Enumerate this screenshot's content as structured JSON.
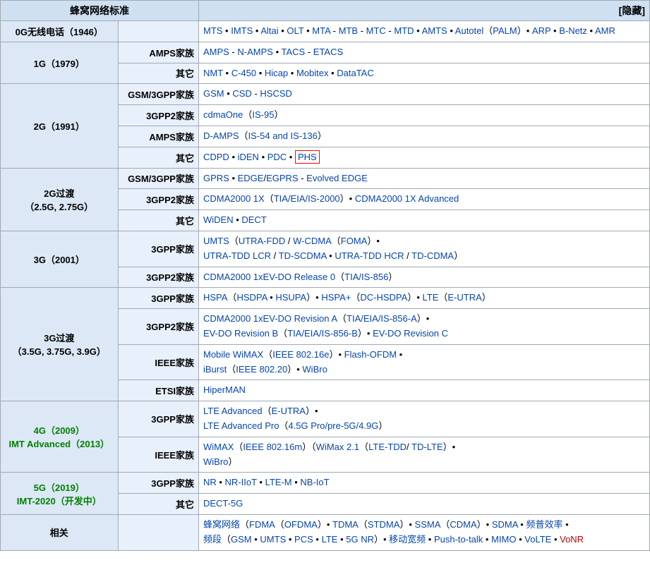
{
  "table": {
    "title": "蜂窝网络标准",
    "hide_label": "[隐藏]",
    "rows": [
      {
        "gen": "0G无线电话（1946）",
        "gen_color": "normal",
        "rowspan": 1,
        "families": [
          {
            "family": "",
            "content": "MTS • IMTS • Altai • OLT • MTA - MTB - MTC - MTD • AMTS • Autotel（PALM）• ARP • B-Netz • AMR"
          }
        ]
      },
      {
        "gen": "1G（1979）",
        "gen_color": "normal",
        "rowspan": 2,
        "families": [
          {
            "family": "AMPS家族",
            "content": "AMPS - N-AMPS • TACS - ETACS"
          },
          {
            "family": "其它",
            "content": "NMT • C-450 • Hicap • Mobitex • DataTAC"
          }
        ]
      },
      {
        "gen": "2G（1991）",
        "gen_color": "normal",
        "rowspan": 4,
        "families": [
          {
            "family": "GSM/3GPP家族",
            "content": "GSM • CSD - HSCSD"
          },
          {
            "family": "3GPP2家族",
            "content": "cdmaOne（IS-95）"
          },
          {
            "family": "AMPS家族",
            "content": "D-AMPS（IS-54 and IS-136）"
          },
          {
            "family": "其它",
            "content": "CDPD • iDEN • PDC • PHS",
            "phs": true
          }
        ]
      },
      {
        "gen": "2G过渡\n（2.5G, 2.75G）",
        "gen_color": "normal",
        "rowspan": 3,
        "families": [
          {
            "family": "GSM/3GPP家族",
            "content": "GPRS • EDGE/EGPRS - Evolved EDGE"
          },
          {
            "family": "3GPP2家族",
            "content": "CDMA2000 1X（TIA/EIA/IS-2000）• CDMA2000 1X Advanced"
          },
          {
            "family": "其它",
            "content": "WiDEN • DECT"
          }
        ]
      },
      {
        "gen": "3G（2001）",
        "gen_color": "normal",
        "rowspan": 2,
        "families": [
          {
            "family": "3GPP家族",
            "content": "UMTS（UTRA-FDD / W-CDMA（FOMA）•\nUTRA-TDD LCR / TD-SCDMA • UTRA-TDD HCR / TD-CDMA）"
          },
          {
            "family": "3GPP2家族",
            "content": "CDMA2000 1xEV-DO Release 0（TIA/IS-856）"
          }
        ]
      },
      {
        "gen": "3G过渡\n（3.5G, 3.75G, 3.9G）",
        "gen_color": "normal",
        "rowspan": 4,
        "families": [
          {
            "family": "3GPP家族",
            "content": "HSPA（HSDPA • HSUPA）• HSPA+（DC-HSDPA）• LTE（E-UTRA）"
          },
          {
            "family": "3GPP2家族",
            "content": "CDMA2000 1xEV-DO Revision A（TIA/EIA/IS-856-A）•\nEV-DO Revision B（TIA/EIA/IS-856-B）• EV-DO Revision C"
          },
          {
            "family": "IEEE家族",
            "content": "Mobile WiMAX（IEEE 802.16e）• Flash-OFDM •\niBurst（IEEE 802.20）• WiBro"
          },
          {
            "family": "ETSI家族",
            "content": "HiperMAN"
          }
        ]
      },
      {
        "gen": "4G（2009）\nIMT Advanced（2013）",
        "gen_color": "green",
        "rowspan": 2,
        "families": [
          {
            "family": "3GPP家族",
            "content": "LTE Advanced（E-UTRA）•\nLTE Advanced Pro（4.5G Pro/pre-5G/4.9G）"
          },
          {
            "family": "IEEE家族",
            "content": "WiMAX（IEEE 802.16m）（WiMax 2.1（LTE-TDD/ TD-LTE）•\nWiBro）"
          }
        ]
      },
      {
        "gen": "5G（2019）\nIMT-2020（开发中）",
        "gen_color": "green",
        "rowspan": 2,
        "families": [
          {
            "family": "3GPP家族",
            "content": "NR • NR-IIoT • LTE-M • NB-IoT"
          },
          {
            "family": "其它",
            "content": "DECT-5G"
          }
        ]
      },
      {
        "gen": "相关",
        "gen_color": "normal",
        "rowspan": 1,
        "families": [
          {
            "family": "",
            "content": "蜂窝网络（FDMA（OFDMA）• TDMA（STDMA）• SSMA（CDMA）• SDMA • 频普效率 •\n频段（GSM • UMTS • PCS • LTE • 5G NR）• 移动宽频 • Push-to-talk • MIMO • VoLTE • VoNR"
          }
        ]
      }
    ]
  }
}
